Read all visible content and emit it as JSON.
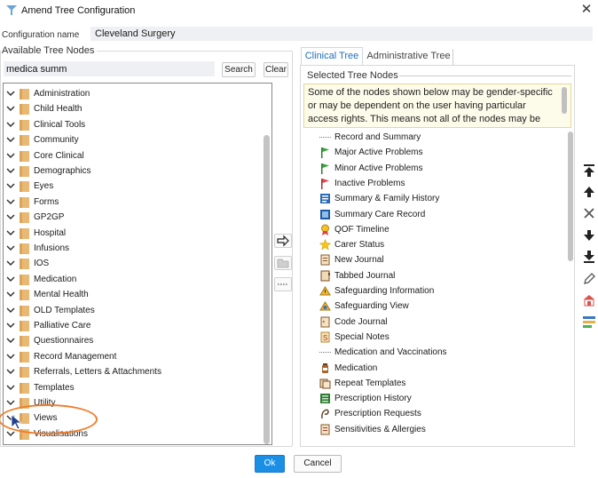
{
  "window": {
    "title": "Amend Tree Configuration",
    "close_label": "✕"
  },
  "config": {
    "label": "Configuration name",
    "value": "Cleveland Surgery"
  },
  "available": {
    "label": "Available Tree Nodes",
    "search_value": "medica summ",
    "search_button": "Search",
    "clear_button": "Clear",
    "nodes": [
      "Administration",
      "Child Health",
      "Clinical Tools",
      "Community",
      "Core Clinical",
      "Demographics",
      "Eyes",
      "Forms",
      "GP2GP",
      "Hospital",
      "Infusions",
      "IOS",
      "Medication",
      "Mental Health",
      "OLD Templates",
      "Palliative Care",
      "Questionnaires",
      "Record Management",
      "Referrals, Letters & Attachments",
      "Templates",
      "Utility",
      "Views",
      "Visualisations"
    ]
  },
  "tabs": {
    "clinical": "Clinical Tree",
    "administrative": "Administrative Tree"
  },
  "selected": {
    "label": "Selected Tree Nodes",
    "info": "Some of the nodes shown below may be gender-specific or may be dependent on the user having particular access rights. This means not all of the nodes may be visible when",
    "nodes": [
      {
        "label": "Record and Summary",
        "icon": "dotted-line-icon"
      },
      {
        "label": "Major Active Problems",
        "icon": "green-flag-icon"
      },
      {
        "label": "Minor Active Problems",
        "icon": "green-flag-icon"
      },
      {
        "label": "Inactive Problems",
        "icon": "red-flag-icon"
      },
      {
        "label": "Summary & Family History",
        "icon": "family-history-icon"
      },
      {
        "label": "Summary Care Record",
        "icon": "care-record-icon"
      },
      {
        "label": "QOF Timeline",
        "icon": "qof-ribbon-icon"
      },
      {
        "label": "Carer Status",
        "icon": "star-icon"
      },
      {
        "label": "New Journal",
        "icon": "journal-icon"
      },
      {
        "label": "Tabbed Journal",
        "icon": "tabbed-journal-icon"
      },
      {
        "label": "Safeguarding Information",
        "icon": "safeguarding-icon"
      },
      {
        "label": "Safeguarding View",
        "icon": "safeguarding-view-icon"
      },
      {
        "label": "Code Journal",
        "icon": "code-journal-icon"
      },
      {
        "label": "Special Notes",
        "icon": "special-notes-icon"
      },
      {
        "label": "Medication and Vaccinations",
        "icon": "dotted-line-icon"
      },
      {
        "label": "Medication",
        "icon": "medication-bottle-icon"
      },
      {
        "label": "Repeat Templates",
        "icon": "repeat-templates-icon"
      },
      {
        "label": "Prescription History",
        "icon": "prescription-history-icon"
      },
      {
        "label": "Prescription Requests",
        "icon": "prescription-requests-icon"
      },
      {
        "label": "Sensitivities & Allergies",
        "icon": "allergies-icon"
      }
    ]
  },
  "buttons": {
    "ok": "Ok",
    "cancel": "Cancel"
  },
  "colors": {
    "accent": "#1a8fe3",
    "folder": "#e9b872",
    "highlight": "#f07d2a"
  }
}
